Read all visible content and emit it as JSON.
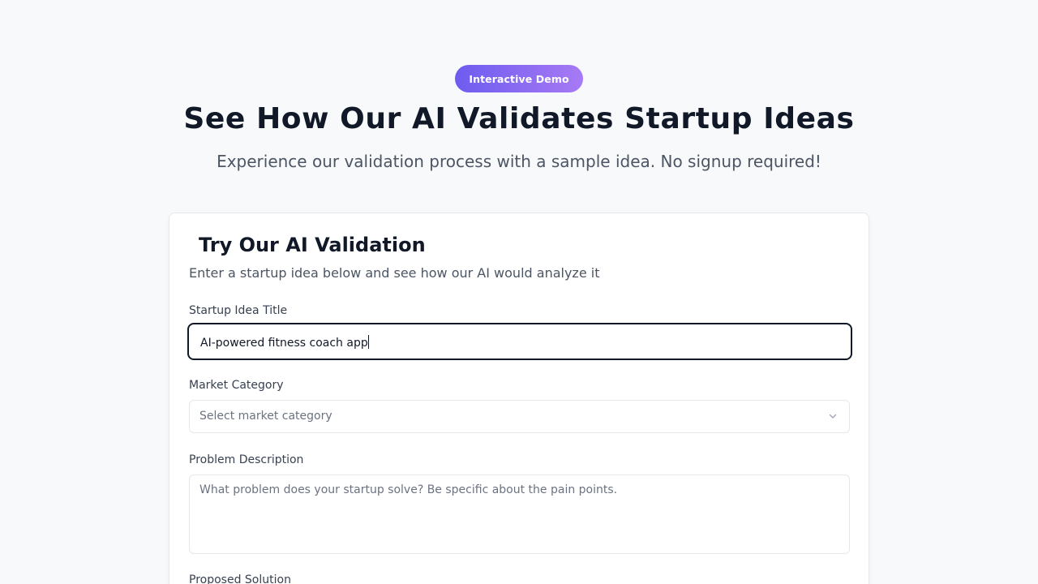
{
  "hero": {
    "badge": "Interactive Demo",
    "title": "See How Our AI Validates Startup Ideas",
    "subtitle": "Experience our validation process with a sample idea. No signup required!"
  },
  "form": {
    "title": "Try Our AI Validation",
    "description": "Enter a startup idea below and see how our AI would analyze it",
    "idea_title": {
      "label": "Startup Idea Title",
      "value": "AI-powered fitness coach app"
    },
    "market_category": {
      "label": "Market Category",
      "placeholder": "Select market category",
      "icon": "chevron-down-icon"
    },
    "problem_description": {
      "label": "Problem Description",
      "placeholder": "What problem does your startup solve? Be specific about the pain points."
    },
    "proposed_solution": {
      "label": "Proposed Solution"
    }
  },
  "colors": {
    "badge_gradient_start": "#6d5cf0",
    "badge_gradient_end": "#a77af4",
    "focus_border": "#111827"
  }
}
